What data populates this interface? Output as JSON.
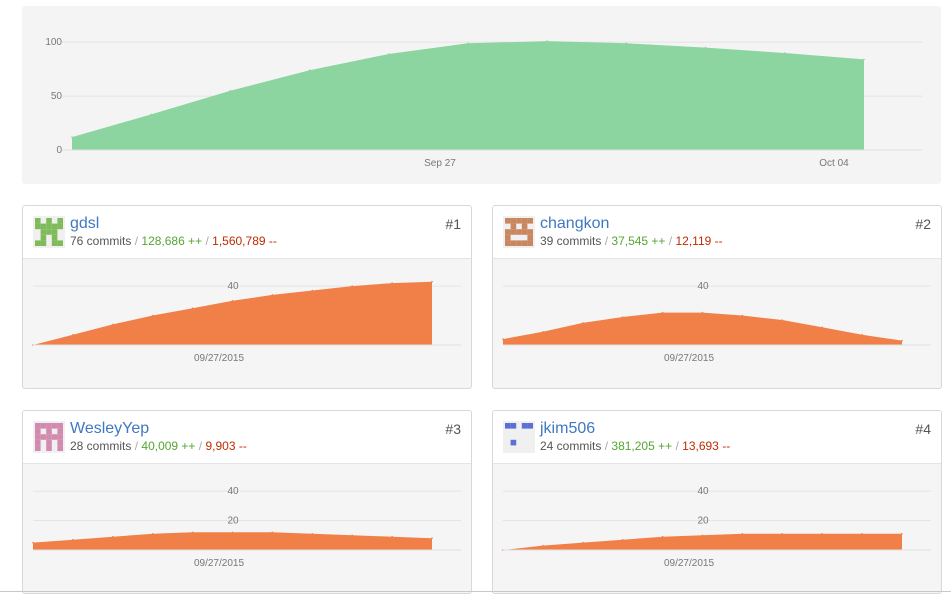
{
  "chart_data": [
    {
      "type": "area",
      "x_tick_labels": [
        "Sep 27",
        "Oct 04"
      ],
      "y_ticks": [
        0,
        50,
        100
      ],
      "ylim": [
        0,
        115
      ],
      "x": [
        0,
        0.1,
        0.2,
        0.3,
        0.4,
        0.5,
        0.6,
        0.7,
        0.8,
        0.9,
        1.0
      ],
      "values": [
        12,
        33,
        55,
        74,
        89,
        99,
        101,
        99,
        95,
        90,
        84
      ],
      "color": "#8cd4a0",
      "grid": true
    },
    {
      "type": "area",
      "contributor": "gdsl",
      "x_tick_labels": [
        "09/27/2015"
      ],
      "y_ticks": [
        40
      ],
      "ylim": [
        0,
        55
      ],
      "x": [
        0,
        0.1,
        0.2,
        0.3,
        0.4,
        0.5,
        0.6,
        0.7,
        0.8,
        0.9,
        1.0
      ],
      "values": [
        0,
        7,
        14,
        20,
        25,
        30,
        34,
        37,
        40,
        42,
        43
      ],
      "color": "#f08048"
    },
    {
      "type": "area",
      "contributor": "changkon",
      "x_tick_labels": [
        "09/27/2015"
      ],
      "y_ticks": [
        40
      ],
      "ylim": [
        0,
        55
      ],
      "x": [
        0,
        0.1,
        0.2,
        0.3,
        0.4,
        0.5,
        0.6,
        0.7,
        0.8,
        0.9,
        1.0
      ],
      "values": [
        4,
        9,
        15,
        19,
        22,
        22,
        20,
        17,
        12,
        7,
        3
      ],
      "color": "#f08048"
    },
    {
      "type": "area",
      "contributor": "WesleyYep",
      "x_tick_labels": [
        "09/27/2015"
      ],
      "y_ticks": [
        20,
        40
      ],
      "ylim": [
        0,
        55
      ],
      "x": [
        0,
        0.1,
        0.2,
        0.3,
        0.4,
        0.5,
        0.6,
        0.7,
        0.8,
        0.9,
        1.0
      ],
      "values": [
        5,
        7,
        9,
        11,
        12,
        12,
        12,
        11,
        10,
        9,
        8
      ],
      "color": "#f08048"
    },
    {
      "type": "area",
      "contributor": "jkim506",
      "x_tick_labels": [
        "09/27/2015"
      ],
      "y_ticks": [
        20,
        40
      ],
      "ylim": [
        0,
        55
      ],
      "x": [
        0,
        0.1,
        0.2,
        0.3,
        0.4,
        0.5,
        0.6,
        0.7,
        0.8,
        0.9,
        1.0
      ],
      "values": [
        0,
        3,
        5,
        7,
        9,
        10,
        11,
        11,
        11,
        11,
        11
      ],
      "color": "#f08048"
    }
  ],
  "contributors": [
    {
      "name": "gdsl",
      "rank": "#1",
      "commits": "76 commits",
      "additions": "128,686 ++",
      "deletions": "1,560,789 --",
      "avatar_icon": "identicon-green",
      "avatar_color": "#7fbb5a"
    },
    {
      "name": "changkon",
      "rank": "#2",
      "commits": "39 commits",
      "additions": "37,545 ++",
      "deletions": "12,119 --",
      "avatar_icon": "identicon-brown",
      "avatar_color": "#c9875f"
    },
    {
      "name": "WesleyYep",
      "rank": "#3",
      "commits": "28 commits",
      "additions": "40,009 ++",
      "deletions": "9,903 --",
      "avatar_icon": "identicon-pink",
      "avatar_color": "#d38aaf"
    },
    {
      "name": "jkim506",
      "rank": "#4",
      "commits": "24 commits",
      "additions": "381,205 ++",
      "deletions": "13,693 --",
      "avatar_icon": "identicon-blue",
      "avatar_color": "#5b6fd6"
    }
  ],
  "separator": "/"
}
